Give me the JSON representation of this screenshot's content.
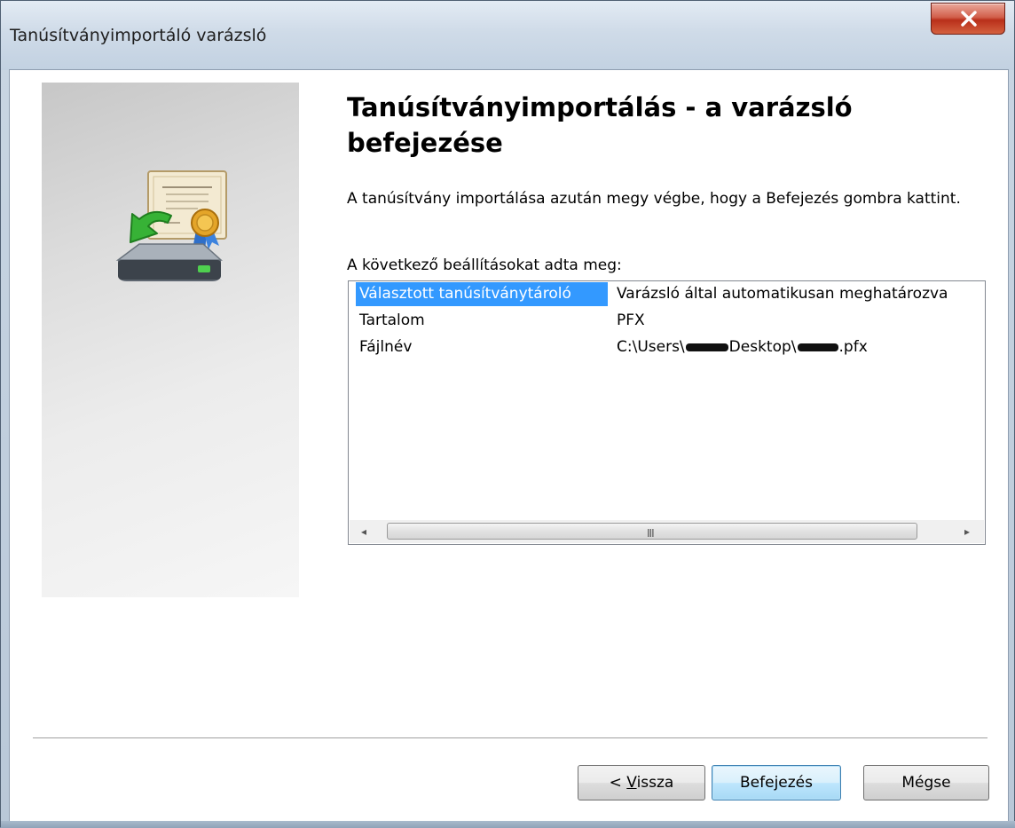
{
  "window": {
    "title": "Tanúsítványimportáló varázsló",
    "close_symbol": "x"
  },
  "main": {
    "heading": "Tanúsítványimportálás - a varázsló befejezése",
    "description": "A tanúsítvány importálása azután megy végbe, hogy a Befejezés gombra kattint.",
    "settings_label": "A következő beállításokat adta meg:",
    "icon": "certificate-import-icon"
  },
  "settings": [
    {
      "name": "Választott tanúsítványtároló",
      "value": "Varázsló által automatikusan meghatározva",
      "selected": true
    },
    {
      "name": "Tartalom",
      "value": "PFX",
      "selected": false
    },
    {
      "name": "Fájlnév",
      "value_prefix": "C:\\Users\\",
      "value_mid": "Desktop\\",
      "value_suffix": ".pfx",
      "selected": false
    }
  ],
  "scrollbar": {
    "left_arrow": "◂",
    "right_arrow": "▸",
    "grip": "III"
  },
  "buttons": {
    "back_prefix": "< ",
    "back_accel": "V",
    "back_rest": "issza",
    "finish": "Befejezés",
    "cancel": "Mégse"
  },
  "colors": {
    "selection": "#3399ff",
    "default_button_border": "#3c7fb1"
  }
}
